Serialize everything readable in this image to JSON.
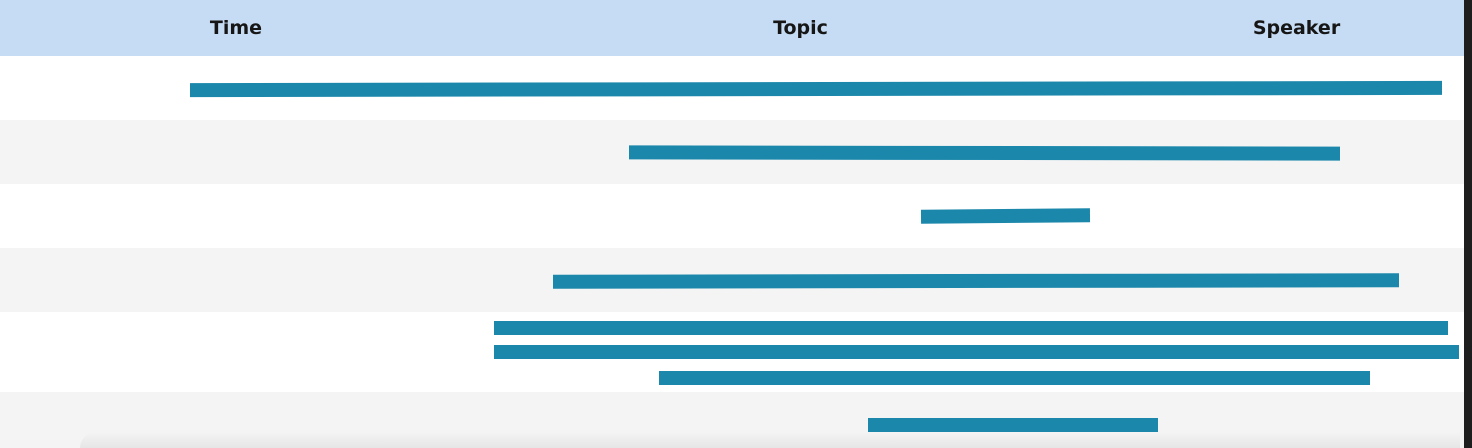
{
  "table": {
    "headers": {
      "time": "Time",
      "topic": "Topic",
      "speaker": "Speaker"
    }
  },
  "redaction_color": "#1b87ab",
  "header_color": "#c6dcf4",
  "alt_row_color": "#f4f4f4"
}
